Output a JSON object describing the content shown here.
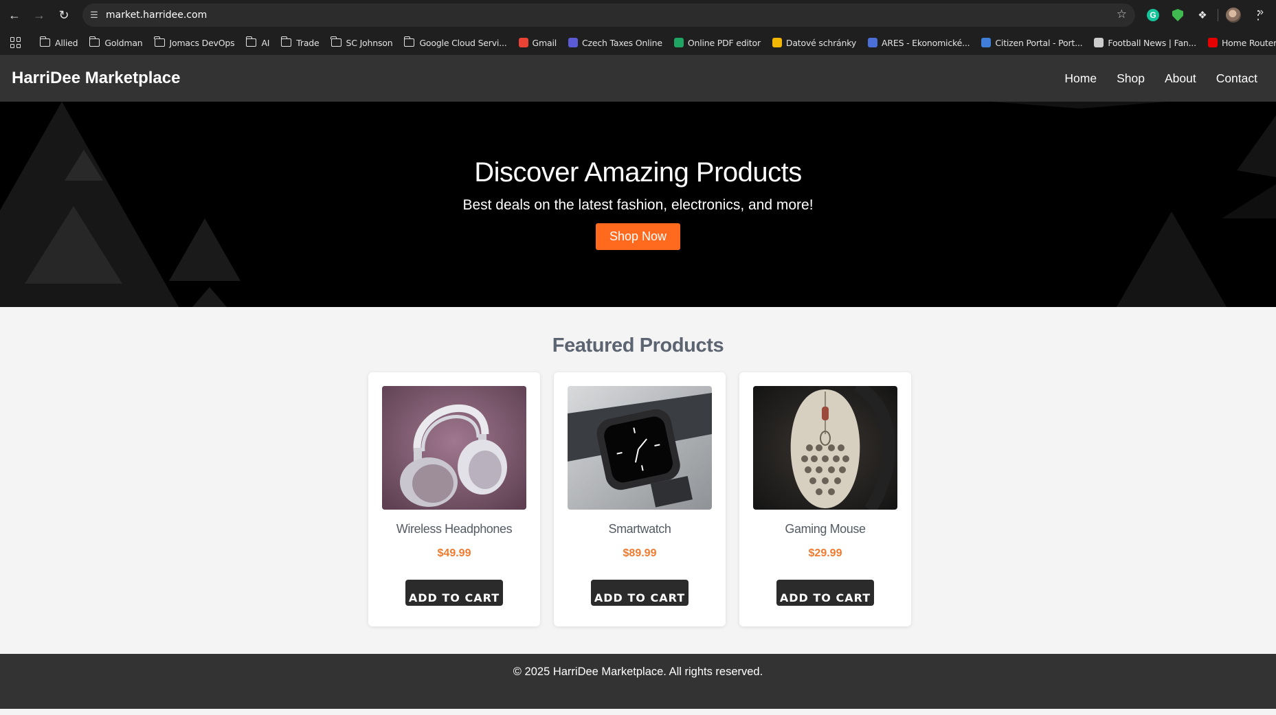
{
  "browser": {
    "url": "market.harridee.com",
    "bookmarks": [
      {
        "label": "Allied",
        "type": "folder"
      },
      {
        "label": "Goldman",
        "type": "folder"
      },
      {
        "label": "Jomacs DevOps",
        "type": "folder"
      },
      {
        "label": "AI",
        "type": "folder"
      },
      {
        "label": "Trade",
        "type": "folder"
      },
      {
        "label": "SC Johnson",
        "type": "folder"
      },
      {
        "label": "Google Cloud Servi...",
        "type": "folder"
      },
      {
        "label": "Gmail",
        "type": "link",
        "icon": "gmail-icon",
        "color": "#ea4335"
      },
      {
        "label": "Czech Taxes Online",
        "type": "link",
        "icon": "czech-taxes-icon",
        "color": "#5b5bd6"
      },
      {
        "label": "Online PDF editor",
        "type": "link",
        "icon": "pdf-editor-icon",
        "color": "#1fa463"
      },
      {
        "label": "Datové schránky",
        "type": "link",
        "icon": "mailbox-icon",
        "color": "#f2b705"
      },
      {
        "label": "ARES - Ekonomické...",
        "type": "link",
        "icon": "ares-icon",
        "color": "#4a6fd8"
      },
      {
        "label": "Citizen Portal - Port...",
        "type": "link",
        "icon": "citizen-portal-icon",
        "color": "#3f7fd9"
      },
      {
        "label": "Football News | Fan...",
        "type": "link",
        "icon": "football-news-icon",
        "color": "#cccccc"
      },
      {
        "label": "Home Router",
        "type": "link",
        "icon": "home-router-icon",
        "color": "#e60000"
      }
    ]
  },
  "site": {
    "logo": "HarriDee Marketplace",
    "nav": [
      "Home",
      "Shop",
      "About",
      "Contact"
    ]
  },
  "hero": {
    "title": "Discover Amazing Products",
    "subtitle": "Best deals on the latest fashion, electronics, and more!",
    "cta": "Shop Now",
    "accent_color": "#ff6a1f"
  },
  "featured": {
    "title": "Featured Products",
    "products": [
      {
        "name": "Wireless Headphones",
        "price": "$49.99",
        "button": "ADD TO CART",
        "image": "headphones-image"
      },
      {
        "name": "Smartwatch",
        "price": "$89.99",
        "button": "ADD TO CART",
        "image": "smartwatch-image"
      },
      {
        "name": "Gaming Mouse",
        "price": "$29.99",
        "button": "ADD TO CART",
        "image": "gaming-mouse-image"
      }
    ]
  },
  "footer": {
    "text": "© 2025 HarriDee Marketplace. All rights reserved."
  }
}
